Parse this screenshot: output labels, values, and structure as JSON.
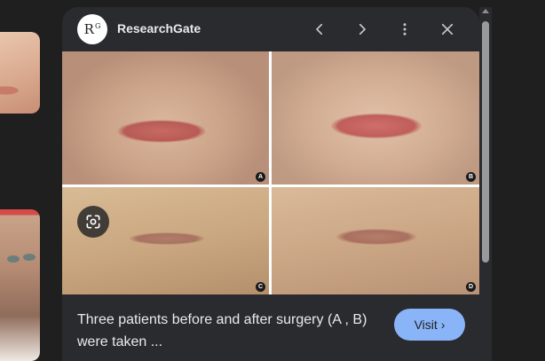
{
  "panel": {
    "source_name": "ResearchGate",
    "logo_text": "R",
    "logo_superscript": "G",
    "caption": "Three patients before and after surgery (A , B) were taken ...",
    "visit_label": "Visit",
    "visit_chevron": "›"
  },
  "image": {
    "labels": [
      "A",
      "B",
      "C",
      "D"
    ]
  },
  "icons": {
    "prev": "chevron-left-icon",
    "next": "chevron-right-icon",
    "more": "more-vert-icon",
    "close": "close-icon",
    "lens": "google-lens-icon"
  },
  "colors": {
    "background": "#1f1f1f",
    "panel": "#2a2b2e",
    "visit_button": "#8ab4f8",
    "text": "#e8eaed"
  }
}
